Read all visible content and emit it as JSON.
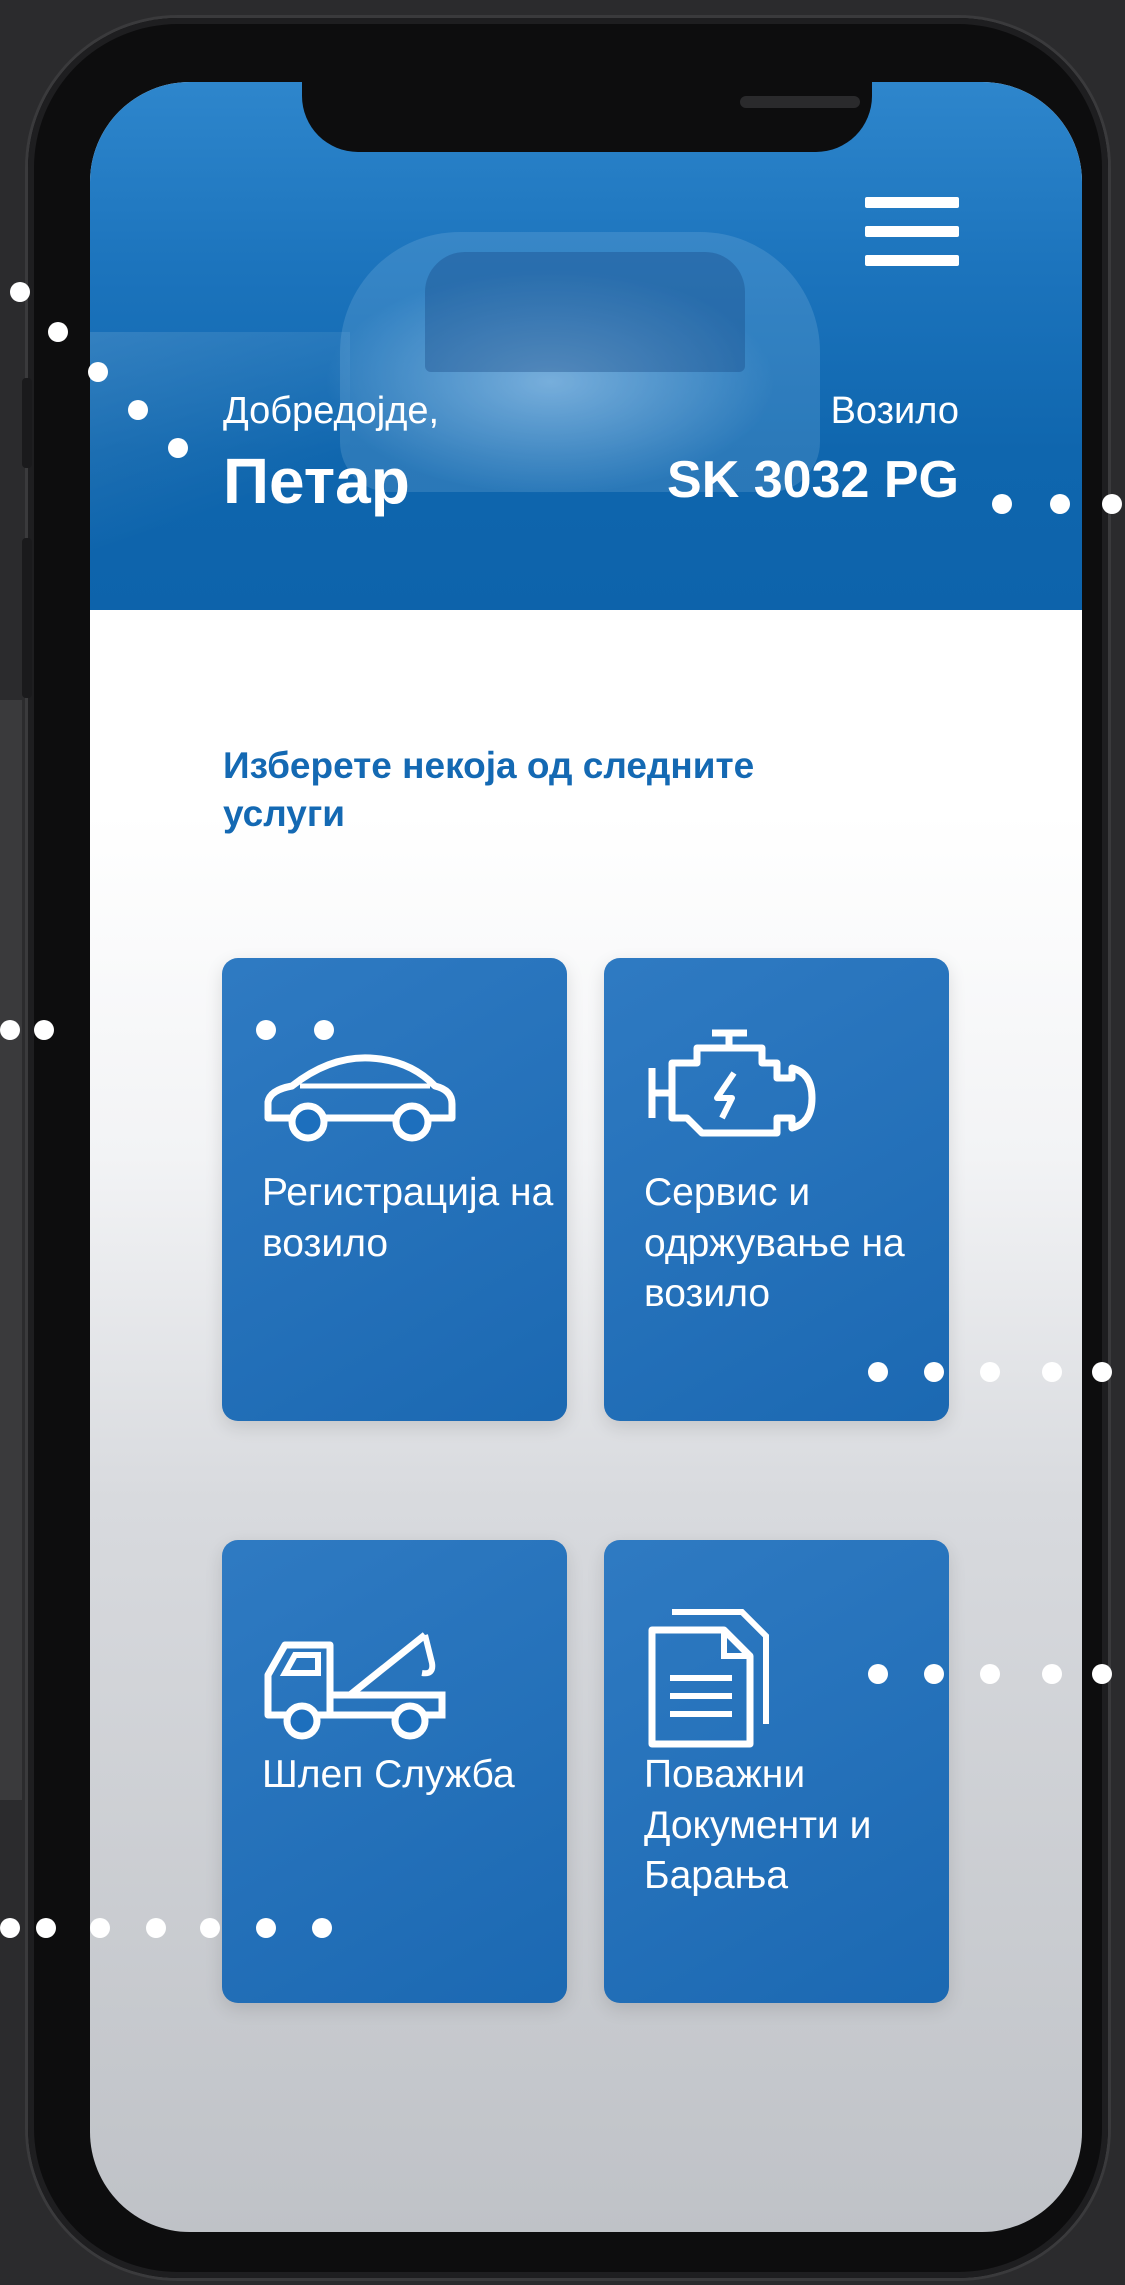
{
  "header": {
    "welcome_label": "Добредојде,",
    "user_name": "Петар",
    "vehicle_label": "Возило",
    "vehicle_plate": "SK 3032 PG"
  },
  "services": {
    "prompt": "Изберете некоја од следните услуги",
    "items": [
      {
        "label": "Регистрација на возило",
        "icon": "car-icon"
      },
      {
        "label": "Сервис и одржување на возило",
        "icon": "engine-icon"
      },
      {
        "label": "Шлеп Служба",
        "icon": "tow-truck-icon"
      },
      {
        "label": "Поважни Документи и Барања",
        "icon": "documents-icon"
      }
    ]
  },
  "colors": {
    "accent": "#1469b3",
    "tile": "#1d6fbd",
    "header": "#1c74bd"
  },
  "icons": [
    "menu-icon",
    "car-icon",
    "engine-icon",
    "tow-truck-icon",
    "documents-icon"
  ]
}
